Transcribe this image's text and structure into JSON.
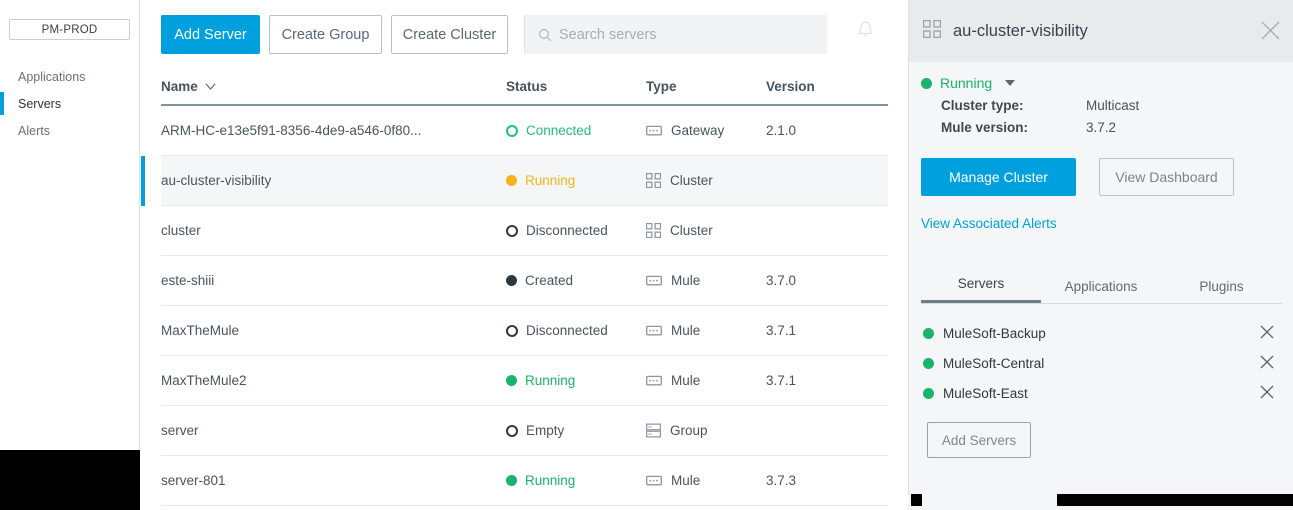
{
  "sidebar": {
    "environment": "PM-PROD",
    "items": [
      {
        "label": "Applications",
        "active": false
      },
      {
        "label": "Servers",
        "active": true
      },
      {
        "label": "Alerts",
        "active": false
      }
    ]
  },
  "toolbar": {
    "add_server_label": "Add Server",
    "create_group_label": "Create Group",
    "create_cluster_label": "Create Cluster",
    "search_placeholder": "Search servers",
    "search_value": "",
    "search_icon": "search-icon",
    "notifications_icon": "bell-icon"
  },
  "table": {
    "columns": {
      "name": "Name",
      "status": "Status",
      "type": "Type",
      "version": "Version"
    },
    "sort_icon": "chevron-down-icon",
    "rows": [
      {
        "name": "ARM-HC-e13e5f91-8356-4de9-a546-0f80...",
        "status": "Connected",
        "status_style": "ring-green",
        "type": "Gateway",
        "type_icon": "mule-runtime-icon",
        "version": "2.1.0",
        "selected": false
      },
      {
        "name": "au-cluster-visibility",
        "status": "Running",
        "status_style": "solid-amber",
        "type": "Cluster",
        "type_icon": "cluster-icon",
        "version": "",
        "selected": true
      },
      {
        "name": "cluster",
        "status": "Disconnected",
        "status_style": "ring-dark",
        "type": "Cluster",
        "type_icon": "cluster-icon",
        "version": "",
        "selected": false
      },
      {
        "name": "este-shiii",
        "status": "Created",
        "status_style": "solid-dark",
        "type": "Mule",
        "type_icon": "mule-runtime-icon",
        "version": "3.7.0",
        "selected": false
      },
      {
        "name": "MaxTheMule",
        "status": "Disconnected",
        "status_style": "ring-dark",
        "type": "Mule",
        "type_icon": "mule-runtime-icon",
        "version": "3.7.1",
        "selected": false
      },
      {
        "name": "MaxTheMule2",
        "status": "Running",
        "status_style": "solid-green",
        "type": "Mule",
        "type_icon": "mule-runtime-icon",
        "version": "3.7.1",
        "selected": false
      },
      {
        "name": "server",
        "status": "Empty",
        "status_style": "ring-dark",
        "type": "Group",
        "type_icon": "server-group-icon",
        "version": "",
        "selected": false
      },
      {
        "name": "server-801",
        "status": "Running",
        "status_style": "solid-green",
        "type": "Mule",
        "type_icon": "mule-runtime-icon",
        "version": "3.7.3",
        "selected": false
      }
    ]
  },
  "panel": {
    "title": "au-cluster-visibility",
    "title_icon": "cluster-icon",
    "close_icon": "close-icon",
    "status": "Running",
    "status_caret_icon": "caret-down-icon",
    "details": [
      {
        "key": "Cluster type:",
        "value": "Multicast"
      },
      {
        "key": "Mule version:",
        "value": "3.7.2"
      }
    ],
    "manage_cluster_label": "Manage Cluster",
    "view_dashboard_label": "View Dashboard",
    "alerts_link_label": "View Associated Alerts",
    "tabs": [
      {
        "label": "Servers",
        "active": true
      },
      {
        "label": "Applications",
        "active": false
      },
      {
        "label": "Plugins",
        "active": false
      }
    ],
    "servers": [
      {
        "name": "MuleSoft-Backup",
        "status_style": "solid-green",
        "remove_icon": "close-icon"
      },
      {
        "name": "MuleSoft-Central",
        "status_style": "solid-green",
        "remove_icon": "close-icon"
      },
      {
        "name": "MuleSoft-East",
        "status_style": "solid-green",
        "remove_icon": "close-icon"
      }
    ],
    "add_servers_label": "Add Servers"
  },
  "colors": {
    "accent": "#00a0df",
    "running_green": "#19b36b",
    "connected_green": "#22c07a",
    "running_amber": "#f5b318",
    "neutral_dark": "#2f3840",
    "selected_row_bg": "#f5f6f7"
  }
}
